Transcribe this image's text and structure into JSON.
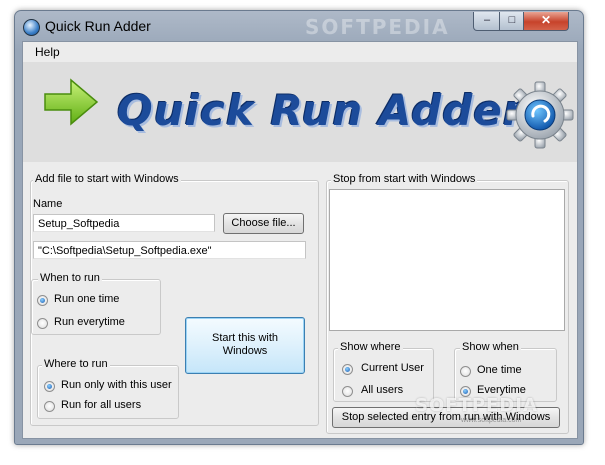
{
  "window": {
    "title": "Quick Run Adder",
    "watermark": "SOFTPEDIA",
    "controls": {
      "minimize": "–",
      "maximize": "□",
      "close": "✕"
    }
  },
  "menu": {
    "help": "Help"
  },
  "banner": {
    "title": "Quick Run Adder",
    "arrow_icon": "green-arrow-icon",
    "gear_icon": "gear-icon"
  },
  "add_group": {
    "legend": "Add file to start with Windows",
    "name_label": "Name",
    "name_value": "Setup_Softpedia",
    "choose_button": "Choose file...",
    "path_value": "\"C:\\Softpedia\\Setup_Softpedia.exe\""
  },
  "when_group": {
    "legend": "When to run",
    "options": [
      {
        "label": "Run one time",
        "selected": true
      },
      {
        "label": "Run everytime",
        "selected": false
      }
    ]
  },
  "where_group": {
    "legend": "Where to run",
    "options": [
      {
        "label": "Run only with this user",
        "selected": true
      },
      {
        "label": "Run for all users",
        "selected": false
      }
    ]
  },
  "start_button": {
    "line1": "Start this with",
    "line2": "Windows"
  },
  "stop_group": {
    "legend": "Stop from start with Windows",
    "entries": [],
    "show_where": {
      "legend": "Show where",
      "options": [
        {
          "label": "Current User",
          "selected": true
        },
        {
          "label": "All users",
          "selected": false
        }
      ]
    },
    "show_when": {
      "legend": "Show when",
      "options": [
        {
          "label": "One time",
          "selected": false
        },
        {
          "label": "Everytime",
          "selected": true
        }
      ]
    },
    "stop_button": "Stop selected entry from run with Windows"
  },
  "watermark": {
    "text": "SOFTPEDIA",
    "url": "www.softpedia.com"
  },
  "colors": {
    "accent": "#1c4b9a",
    "arrow_green": "#7fd321",
    "close_red": "#c7432b"
  }
}
